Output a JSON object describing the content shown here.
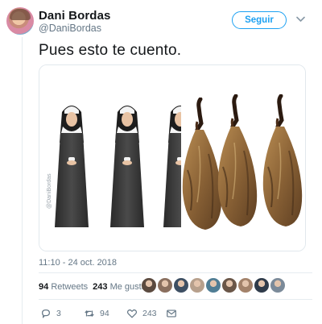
{
  "author": {
    "name": "Dani Bordas",
    "handle": "@DaniBordas"
  },
  "follow_button": {
    "label": "Seguir"
  },
  "tweet": {
    "text": "Pues esto te cuento.",
    "timestamp": "11:10 - 24 oct. 2018"
  },
  "media": {
    "watermark": "@DaniBordas",
    "panels": [
      "nun",
      "nun",
      "nun-to-ham",
      "ham",
      "ham"
    ]
  },
  "stats": {
    "retweets_count": "94",
    "retweets_label": "Retweets",
    "likes_count": "243",
    "likes_label": "Me gusta"
  },
  "likers": [
    "#5b4a3f",
    "#8a6f5e",
    "#3d4f63",
    "#b7a08c",
    "#4f7d94",
    "#6a5648",
    "#a3826a",
    "#2f3b4a",
    "#7b8a99"
  ],
  "actions": {
    "reply_count": "3",
    "retweet_count": "94",
    "like_count": "243"
  },
  "colors": {
    "accent": "#1da1f2",
    "secondary_text": "#657786",
    "divider": "#e6ecf0"
  }
}
